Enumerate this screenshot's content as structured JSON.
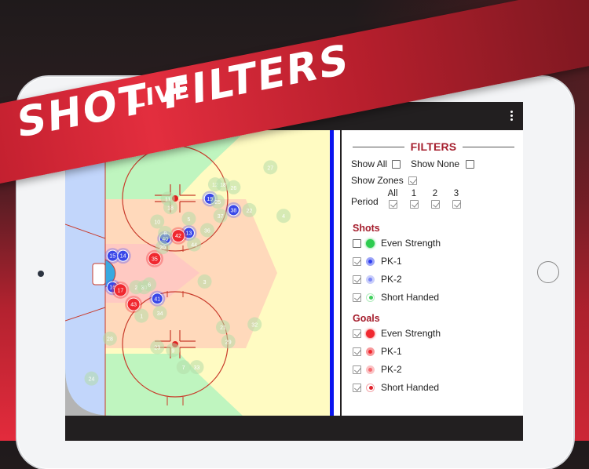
{
  "promo": {
    "line1": "LIVE",
    "line2": "SHOT FILTERS"
  },
  "appbar": {
    "menu_icon": "more-vert-icon"
  },
  "filters": {
    "title": "FILTERS",
    "show_all": {
      "label": "Show All",
      "checked": false
    },
    "show_none": {
      "label": "Show None",
      "checked": false
    },
    "show_zones": {
      "label": "Show Zones",
      "checked": true
    },
    "period": {
      "label": "Period",
      "options": [
        {
          "label": "All",
          "checked": true
        },
        {
          "label": "1",
          "checked": true
        },
        {
          "label": "2",
          "checked": true
        },
        {
          "label": "3",
          "checked": true
        }
      ]
    },
    "shots": {
      "heading": "Shots",
      "items": [
        {
          "label": "Even Strength",
          "checked": false,
          "color": "#2ecc50",
          "style": "solid"
        },
        {
          "label": "PK-1",
          "checked": true,
          "color": "#2f3ff0",
          "style": "ring"
        },
        {
          "label": "PK-2",
          "checked": true,
          "color": "#7b86f5",
          "style": "ring-light"
        },
        {
          "label": "Short Handed",
          "checked": true,
          "color": "#3fcf5c",
          "style": "hollow"
        }
      ]
    },
    "goals": {
      "heading": "Goals",
      "items": [
        {
          "label": "Even Strength",
          "checked": true,
          "color": "#f0282f",
          "style": "solid"
        },
        {
          "label": "PK-1",
          "checked": true,
          "color": "#f0282f",
          "style": "ring"
        },
        {
          "label": "PK-2",
          "checked": true,
          "color": "#f46a6f",
          "style": "ring-light"
        },
        {
          "label": "Short Handed",
          "checked": true,
          "color": "#e0202a",
          "style": "hollow"
        }
      ]
    }
  },
  "rink": {
    "colors": {
      "ice_behind_goal": "#c2d6fb",
      "zone_green": "#bff5bf",
      "zone_orange": "#ffd9bb",
      "zone_yellow": "#fffbc2",
      "zone_slot": "#ffc9c2",
      "crease": "#38a9e0",
      "line_red": "#c83a2a",
      "blue_line": "#0a14f0"
    },
    "shots": [
      {
        "n": "19",
        "type": "pk1",
        "fx": 0.55,
        "fy": 0.24
      },
      {
        "n": "38",
        "type": "pk1",
        "fx": 0.64,
        "fy": 0.28
      },
      {
        "n": "13",
        "type": "pk1",
        "fx": 0.47,
        "fy": 0.36
      },
      {
        "n": "40",
        "type": "pk1",
        "fx": 0.38,
        "fy": 0.38
      },
      {
        "n": "15",
        "type": "pk1",
        "fx": 0.18,
        "fy": 0.44
      },
      {
        "n": "14",
        "type": "pk1",
        "fx": 0.22,
        "fy": 0.44
      },
      {
        "n": "16",
        "type": "pk1",
        "fx": 0.18,
        "fy": 0.55
      },
      {
        "n": "41",
        "type": "pk1",
        "fx": 0.35,
        "fy": 0.59
      },
      {
        "n": "42",
        "type": "goal",
        "fx": 0.43,
        "fy": 0.37
      },
      {
        "n": "35",
        "type": "goal",
        "fx": 0.34,
        "fy": 0.45
      },
      {
        "n": "17",
        "type": "goal",
        "fx": 0.21,
        "fy": 0.56
      },
      {
        "n": "43",
        "type": "goal",
        "fx": 0.26,
        "fy": 0.61
      },
      {
        "n": "27",
        "type": "faint",
        "fx": 0.78,
        "fy": 0.13
      },
      {
        "n": "26",
        "type": "faint",
        "fx": 0.64,
        "fy": 0.2
      },
      {
        "n": "12",
        "type": "faint",
        "fx": 0.57,
        "fy": 0.19
      },
      {
        "n": "18",
        "type": "faint",
        "fx": 0.6,
        "fy": 0.19
      },
      {
        "n": "25",
        "type": "faint",
        "fx": 0.58,
        "fy": 0.25
      },
      {
        "n": "37",
        "type": "faint",
        "fx": 0.59,
        "fy": 0.3
      },
      {
        "n": "22",
        "type": "faint",
        "fx": 0.7,
        "fy": 0.28
      },
      {
        "n": "4",
        "type": "faint",
        "fx": 0.83,
        "fy": 0.3
      },
      {
        "n": "11",
        "type": "faint",
        "fx": 0.39,
        "fy": 0.24
      },
      {
        "n": "18",
        "type": "faint",
        "fx": 0.4,
        "fy": 0.27
      },
      {
        "n": "10",
        "type": "faint",
        "fx": 0.35,
        "fy": 0.32
      },
      {
        "n": "5",
        "type": "faint",
        "fx": 0.47,
        "fy": 0.31
      },
      {
        "n": "36",
        "type": "faint",
        "fx": 0.54,
        "fy": 0.35
      },
      {
        "n": "44",
        "type": "faint",
        "fx": 0.49,
        "fy": 0.4
      },
      {
        "n": "8",
        "type": "faint",
        "fx": 0.38,
        "fy": 0.36
      },
      {
        "n": "20",
        "type": "faint",
        "fx": 0.37,
        "fy": 0.41
      },
      {
        "n": "2",
        "type": "faint",
        "fx": 0.27,
        "fy": 0.55
      },
      {
        "n": "30",
        "type": "faint",
        "fx": 0.3,
        "fy": 0.55
      },
      {
        "n": "6",
        "type": "faint",
        "fx": 0.32,
        "fy": 0.54
      },
      {
        "n": "3",
        "type": "faint",
        "fx": 0.53,
        "fy": 0.53
      },
      {
        "n": "1",
        "type": "faint",
        "fx": 0.29,
        "fy": 0.65
      },
      {
        "n": "34",
        "type": "faint",
        "fx": 0.36,
        "fy": 0.64
      },
      {
        "n": "28",
        "type": "faint",
        "fx": 0.17,
        "fy": 0.73
      },
      {
        "n": "23",
        "type": "faint",
        "fx": 0.35,
        "fy": 0.76
      },
      {
        "n": "9",
        "type": "faint",
        "fx": 0.41,
        "fy": 0.77
      },
      {
        "n": "21",
        "type": "faint",
        "fx": 0.6,
        "fy": 0.69
      },
      {
        "n": "29",
        "type": "faint",
        "fx": 0.62,
        "fy": 0.74
      },
      {
        "n": "32",
        "type": "faint",
        "fx": 0.72,
        "fy": 0.68
      },
      {
        "n": "7",
        "type": "faint",
        "fx": 0.45,
        "fy": 0.83
      },
      {
        "n": "33",
        "type": "faint",
        "fx": 0.5,
        "fy": 0.83
      },
      {
        "n": "24",
        "type": "faint",
        "fx": 0.1,
        "fy": 0.87
      }
    ]
  }
}
